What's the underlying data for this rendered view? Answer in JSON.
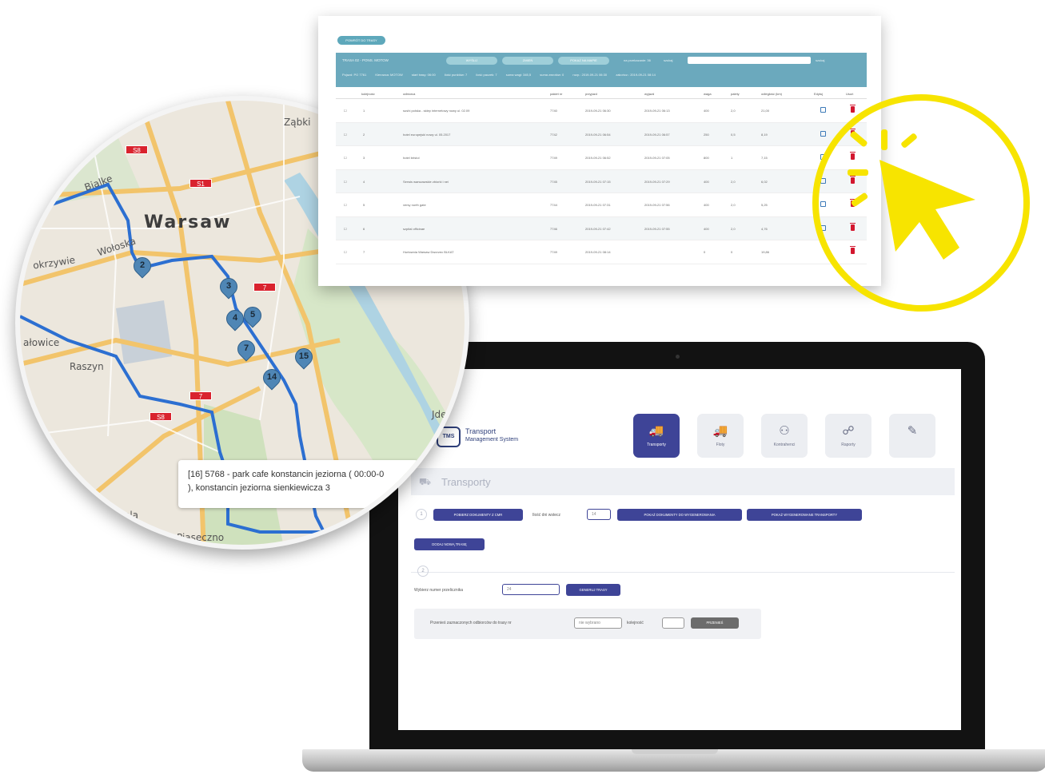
{
  "table_window": {
    "top_button": "POWRÓT DO TRASY",
    "header_title": "TRASA 02 - PONS. MOTOW",
    "header_buttons": [
      "WYŚLIJ",
      "ZMIEŃ",
      "POKAŻ NA MAPIE"
    ],
    "nav_text": "na przekazanie: 36",
    "search_label": "szukaj",
    "search_hint": "szukaj",
    "info": [
      "Pojazd: PO 7761",
      "Kierowca: MOTOW",
      "start trasy: 06:00",
      "ilość punktów: 7",
      "ilość paczek: 7",
      "suma wagi: 345,5",
      "suma zwrotów: 0",
      "rozp.: 2019-09-21 06:30",
      "zakończ.: 2019-09-21 08:14"
    ],
    "columns": [
      "",
      "kolejność",
      "odbiorca",
      "pakiet nr",
      "przyjazd",
      "wyjazd",
      "waga",
      "palety",
      "odległość (km)",
      "Edytuj",
      "Usuń"
    ],
    "rows": [
      {
        "check": "☐",
        "no": "1",
        "name": "sushi polska - sklep internetowy nowy ul. 02.09",
        "pkg": "7740",
        "arr": "2019-09-21 06:30",
        "dep": "2019-09-21 06:13",
        "weight": "400",
        "pallets": "2,0",
        "dist": "21,00"
      },
      {
        "check": "☐",
        "no": "2",
        "name": "hotel europejski nowy ul. 05.2017",
        "pkg": "7742",
        "arr": "2019-09-21 06:54",
        "dep": "2019-09-21 06:57",
        "weight": "250",
        "pallets": "0,5",
        "dist": "8,19"
      },
      {
        "check": "☐",
        "no": "3",
        "name": "hotel bristol",
        "pkg": "7749",
        "arr": "2019-09-21 06:52",
        "dep": "2019-09-21 07:05",
        "weight": "800",
        "pallets": "1",
        "dist": "7,15"
      },
      {
        "check": "☐",
        "no": "4",
        "name": "Serwis warszawskie zbiorki i nei",
        "pkg": "7745",
        "arr": "2019-09-21 07:15",
        "dep": "2019-09-21 07:29",
        "weight": "400",
        "pallets": "2,0",
        "dist": "6,02"
      },
      {
        "check": "☐",
        "no": "5",
        "name": "versy north gate",
        "pkg": "7744",
        "arr": "2019-09-21 07:31",
        "dep": "2019-09-21 07:56",
        "weight": "400",
        "pallets": "2,0",
        "dist": "5,25"
      },
      {
        "check": "☐",
        "no": "6",
        "name": "szpital officinae",
        "pkg": "7746",
        "arr": "2019-09-21 07:42",
        "dep": "2019-09-21 07:55",
        "weight": "400",
        "pallets": "2,0",
        "dist": "4,76"
      },
      {
        "check": "☐",
        "no": "7",
        "name": "Hurtownia Warsaw Dworzec BLKAT",
        "pkg": "7749",
        "arr": "2019-09-21 08:14",
        "dep": "",
        "weight": "0",
        "pallets": "0",
        "dist": "19,86"
      }
    ]
  },
  "map": {
    "city": "Warsaw",
    "places": [
      "Ząbki",
      "Raszyn",
      "Piaseczno",
      "Jde",
      "ałowice",
      "okrzywie",
      "ola",
      "Bialke",
      "Wołoska"
    ],
    "road_numbers": [
      "S8",
      "S1",
      "7",
      "7",
      "S8"
    ],
    "markers": [
      "2",
      "3",
      "4",
      "5",
      "7",
      "14",
      "15"
    ],
    "tooltip_line1": "[16] 5768 - park cafe konstancin jeziorna ( 00:00-0",
    "tooltip_line2": "), konstancin jeziorna sienkiewicza 3"
  },
  "tms": {
    "logo_badge": "TMS",
    "logo_line1": "Transport",
    "logo_line2": "Management System",
    "nav": [
      {
        "icon": "🚚",
        "label": "Transporty"
      },
      {
        "icon": "🚚",
        "label": "Floty"
      },
      {
        "icon": "⚇",
        "label": "Kontrahenci"
      },
      {
        "icon": "☍",
        "label": "Raporty"
      },
      {
        "icon": "✎",
        "label": ""
      }
    ],
    "section_title": "Transporty",
    "step1": "1",
    "step2": "2",
    "btn_import": "POBIERZ DOKUMENTY Z CMR",
    "label_days": "Ilość dni wstecz",
    "days_value": "14",
    "btn_docs": "POKAŻ DOKUMENTY DO WYGENEROWANIA",
    "btn_transport": "POKAŻ WYGENEROWANE TRANSPORTY",
    "btn_new_route": "DODAJ NOWĄ TRASĘ",
    "label_number": "Wybierz numer przelicznika",
    "number_value": "24",
    "btn_generate": "GENERUJ TRASY",
    "label_move": "Przenieś zaznaczonych odbiorców do trasy nr",
    "move_placeholder": "nie wybrano",
    "label_order": "kolejność",
    "btn_move": "PRZENIEŚ"
  },
  "colors": {
    "primary": "#3e4497",
    "teal_header": "#6ba9bd",
    "delete_red": "#d3172f",
    "cursor_yellow": "#f7e400",
    "route_blue": "#2c6fd1"
  }
}
